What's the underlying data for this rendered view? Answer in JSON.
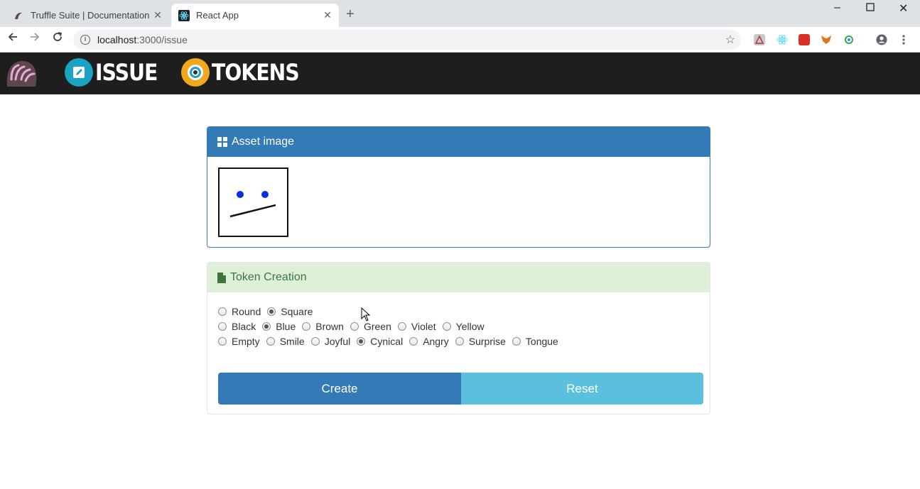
{
  "browser": {
    "tabs": [
      {
        "title": "Truffle Suite | Documentation |",
        "active": false
      },
      {
        "title": "React App",
        "active": true
      }
    ],
    "url_host": "localhost",
    "url_rest": ":3000/issue"
  },
  "nav": {
    "issue_label": "ISSUE",
    "tokens_label": "TOKENS"
  },
  "asset_panel": {
    "title": "Asset image"
  },
  "token_panel": {
    "title": "Token Creation",
    "shape_options": [
      {
        "label": "Round",
        "checked": false
      },
      {
        "label": "Square",
        "checked": true
      }
    ],
    "color_options": [
      {
        "label": "Black",
        "checked": false
      },
      {
        "label": "Blue",
        "checked": true
      },
      {
        "label": "Brown",
        "checked": false
      },
      {
        "label": "Green",
        "checked": false
      },
      {
        "label": "Violet",
        "checked": false
      },
      {
        "label": "Yellow",
        "checked": false
      }
    ],
    "mood_options": [
      {
        "label": "Empty",
        "checked": false
      },
      {
        "label": "Smile",
        "checked": false
      },
      {
        "label": "Joyful",
        "checked": false
      },
      {
        "label": "Cynical",
        "checked": true
      },
      {
        "label": "Angry",
        "checked": false
      },
      {
        "label": "Surprise",
        "checked": false
      },
      {
        "label": "Tongue",
        "checked": false
      }
    ],
    "create_label": "Create",
    "reset_label": "Reset"
  },
  "colors": {
    "primary": "#337ab7",
    "info": "#5bc0de",
    "success_bg": "#dff0d8",
    "success_text": "#3c763d",
    "header_bg": "#1e1e1e",
    "eye_color": "#0033dd"
  }
}
